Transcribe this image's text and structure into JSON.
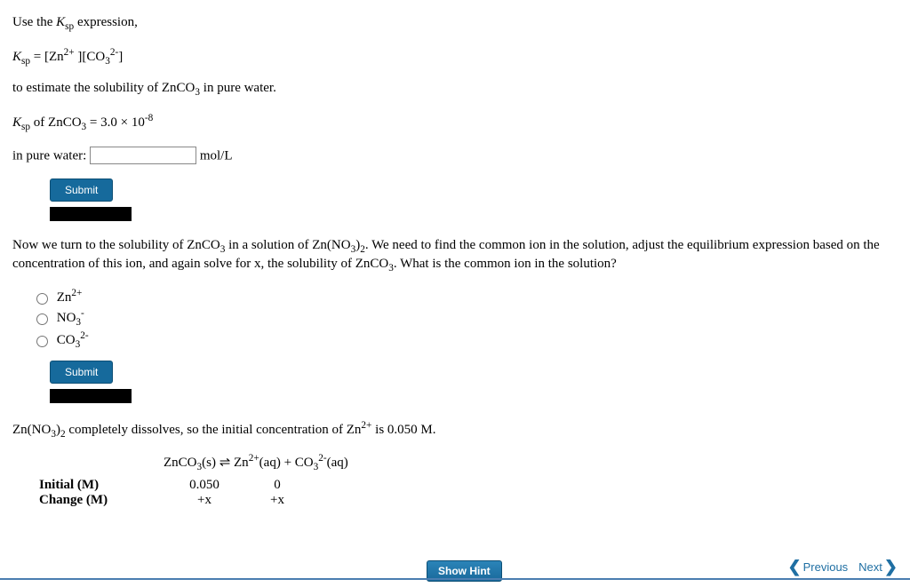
{
  "p1": "Use the ",
  "ksp_ital": "K",
  "sp_sub": "sp",
  "p1b": " expression,",
  "eq1_a": " = [Zn",
  "eq1_b": " ][CO",
  "eq1_c": "]",
  "p2": "to estimate the solubility of ZnCO",
  "p2b": " in pure water.",
  "p3a": " of ZnCO",
  "p3b": " = 3.0 × 10",
  "neg8": "-8",
  "pure_label": "in pure water: ",
  "unit": " mol/L",
  "submit": "Submit",
  "p4a": "Now we turn to the solubility of ZnCO",
  "p4b": " in a solution of Zn(NO",
  "p4c": ")",
  "p4d": ". We need to find the common ion in the solution, adjust the equilibrium expression based on the concentration of this ion, and again solve for x, the solubility of ZnCO",
  "p4e": ". What is the common ion in the solution?",
  "opt1a": "Zn",
  "opt1b": "2+",
  "opt2a": "NO",
  "opt2b": "3",
  "opt2c": "-",
  "opt3a": "CO",
  "opt3b": "3",
  "opt3c": "2-",
  "p5a": "Zn(NO",
  "p5b": ")",
  "p5c": " completely dissolves, so the initial concentration of Zn",
  "p5d": " is 0.050 M.",
  "ice_eq_a": "ZnCO",
  "ice_eq_b": "(s) ⇌ Zn",
  "ice_eq_c": "(aq)  + CO",
  "ice_eq_d": "(aq)",
  "row_initial": "Initial (M)",
  "row_change": "Change (M)",
  "v_initial_zn": "0.050",
  "v_initial_co": "0",
  "v_change_zn": "+x",
  "v_change_co": "+x",
  "show_hint": "Show Hint",
  "prev": "Previous",
  "next": "Next",
  "n2p": "2+",
  "n3": "3",
  "n2": "2",
  "n2m": "2-",
  "minus": "-"
}
